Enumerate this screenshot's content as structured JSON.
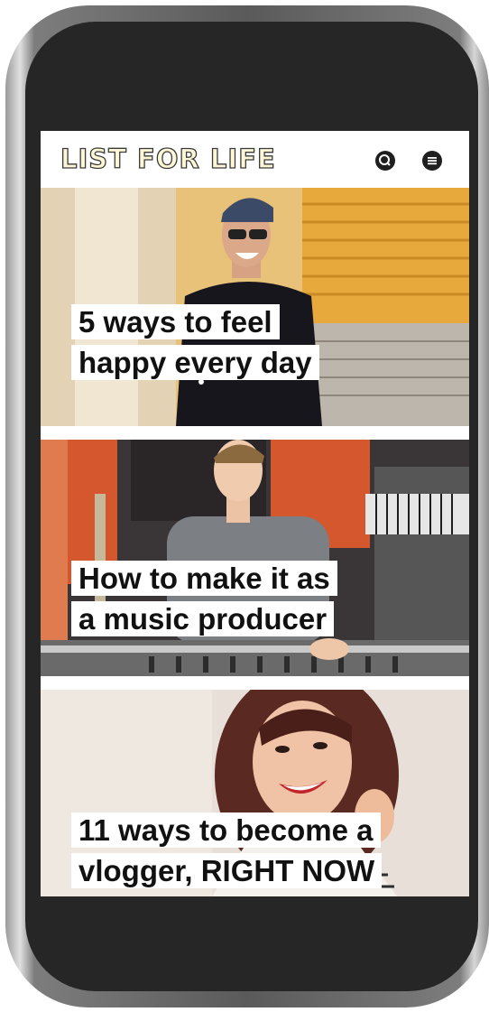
{
  "app": {
    "logo": "LIST FOR LIFE",
    "icons": {
      "search": "search-icon",
      "menu": "menu-icon"
    }
  },
  "articles": [
    {
      "line1": "5 ways to feel",
      "line2": "happy every day"
    },
    {
      "line1": "How to make it as",
      "line2": "a music producer"
    },
    {
      "line1": "11 ways to become a",
      "line2": "vlogger,  RIGHT NOW"
    }
  ],
  "colors": {
    "phone_body": "#262626",
    "logo_fill": "#fdf7d6",
    "headline_bg": "#ffffff",
    "deco_circle": "#fbe6ea"
  }
}
